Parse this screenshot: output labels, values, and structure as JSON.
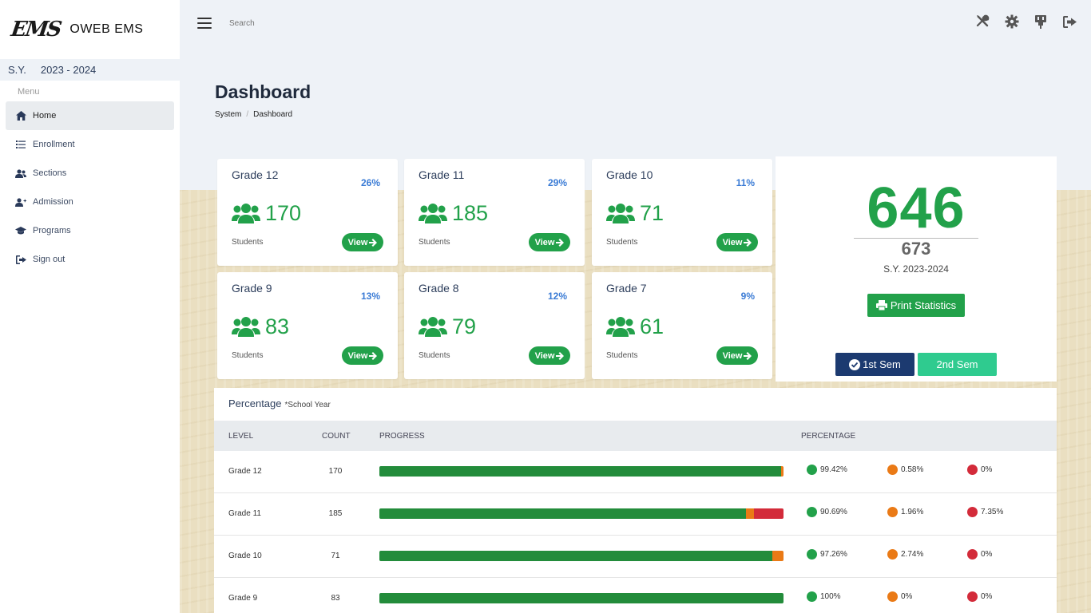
{
  "app": {
    "logo_text": "EMS",
    "name": "OWEB EMS"
  },
  "school_year": {
    "label": "S.Y.",
    "value": "2023 - 2024"
  },
  "menu": {
    "label": "Menu",
    "items": [
      {
        "label": "Home",
        "icon": "home-icon",
        "active": true
      },
      {
        "label": "Enrollment",
        "icon": "list-icon",
        "active": false
      },
      {
        "label": "Sections",
        "icon": "users-icon",
        "active": false
      },
      {
        "label": "Admission",
        "icon": "user-plus-icon",
        "active": false
      },
      {
        "label": "Programs",
        "icon": "graduation-cap-icon",
        "active": false
      },
      {
        "label": "Sign out",
        "icon": "sign-out-icon",
        "active": false
      }
    ]
  },
  "topbar": {
    "search_placeholder": "Search",
    "icons": [
      "tools-icon",
      "settings-icon",
      "plug-icon",
      "logout-icon"
    ]
  },
  "page": {
    "title": "Dashboard",
    "breadcrumb": [
      "System",
      "Dashboard"
    ]
  },
  "grades": [
    {
      "name": "Grade 12",
      "pct": "26%",
      "count": "170",
      "sub": "Students",
      "view": "View"
    },
    {
      "name": "Grade 11",
      "pct": "29%",
      "count": "185",
      "sub": "Students",
      "view": "View"
    },
    {
      "name": "Grade 10",
      "pct": "11%",
      "count": "71",
      "sub": "Students",
      "view": "View"
    },
    {
      "name": "Grade 9",
      "pct": "13%",
      "count": "83",
      "sub": "Students",
      "view": "View"
    },
    {
      "name": "Grade 8",
      "pct": "12%",
      "count": "79",
      "sub": "Students",
      "view": "View"
    },
    {
      "name": "Grade 7",
      "pct": "9%",
      "count": "61",
      "sub": "Students",
      "view": "View"
    }
  ],
  "totals": {
    "enrolled": "646",
    "total": "673",
    "school_year": "S.Y. 2023-2024",
    "print_label": "Print Statistics",
    "sem1_label": "1st Sem",
    "sem2_label": "2nd Sem"
  },
  "percentage_table": {
    "title": "Percentage",
    "subtitle": "*School Year",
    "headers": {
      "level": "LEVEL",
      "count": "COUNT",
      "progress": "PROGRESS",
      "percentage": "PERCENTAGE"
    },
    "rows": [
      {
        "level": "Grade 12",
        "count": "170",
        "green": 99.42,
        "orange": 0.58,
        "red": 0,
        "green_label": "99.42%",
        "orange_label": "0.58%",
        "red_label": "0%"
      },
      {
        "level": "Grade 11",
        "count": "185",
        "green": 90.69,
        "orange": 1.96,
        "red": 7.35,
        "green_label": "90.69%",
        "orange_label": "1.96%",
        "red_label": "7.35%"
      },
      {
        "level": "Grade 10",
        "count": "71",
        "green": 97.26,
        "orange": 2.74,
        "red": 0,
        "green_label": "97.26%",
        "orange_label": "2.74%",
        "red_label": "0%"
      },
      {
        "level": "Grade 9",
        "count": "83",
        "green": 100,
        "orange": 0,
        "red": 0,
        "green_label": "100%",
        "orange_label": "0%",
        "red_label": "0%"
      }
    ]
  },
  "colors": {
    "green": "#22a14a",
    "bar_green": "#238c3b",
    "orange": "#ea7a16",
    "red": "#d32b3a",
    "navy": "#1c3a70",
    "teal": "#2fcb8f",
    "blue_pct": "#3a7bd5"
  }
}
